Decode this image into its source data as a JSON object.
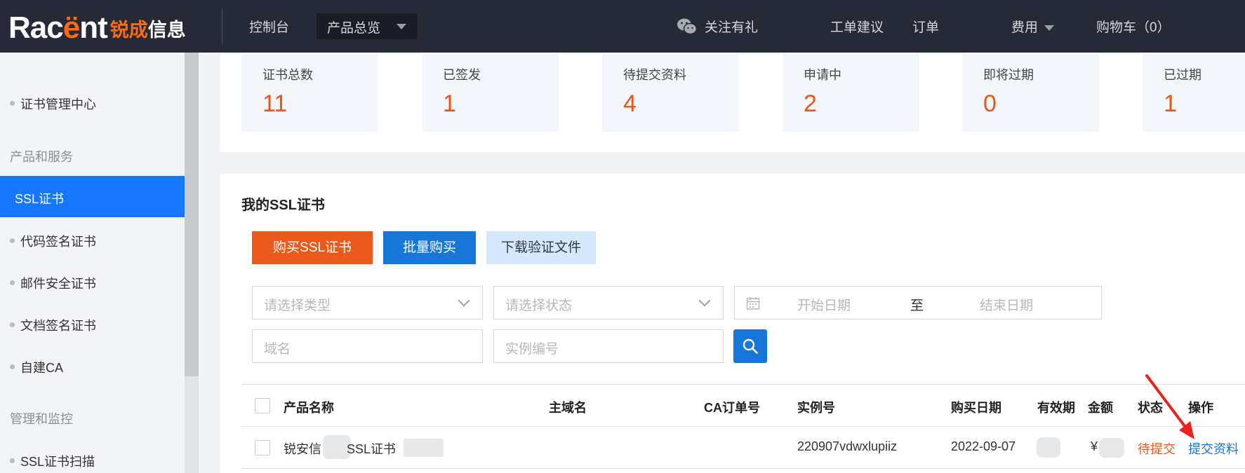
{
  "topbar": {
    "logo_text_1": "Rac",
    "logo_text_2": "ë",
    "logo_text_3": "nt",
    "logo_cn_1": "锐成",
    "logo_cn_2": "信息",
    "console": "控制台",
    "products_dropdown": "产品总览",
    "follow_gift": "关注有礼",
    "ticket": "工单建议",
    "orders": "订单",
    "fees": "费用",
    "cart": "购物车（0）"
  },
  "sidebar": {
    "cert_center": "证书管理中心",
    "group_products": "产品和服务",
    "ssl": "SSL证书",
    "code_sign": "代码签名证书",
    "mail_sec": "邮件安全证书",
    "doc_sign": "文档签名证书",
    "self_ca": "自建CA",
    "group_manage": "管理和监控",
    "ssl_scan": "SSL证书扫描"
  },
  "stats": [
    {
      "label": "证书总数",
      "value": "11"
    },
    {
      "label": "已签发",
      "value": "1"
    },
    {
      "label": "待提交资料",
      "value": "4"
    },
    {
      "label": "申请中",
      "value": "2"
    },
    {
      "label": "即将过期",
      "value": "0"
    },
    {
      "label": "已过期",
      "value": "1"
    }
  ],
  "main": {
    "title": "我的SSL证书",
    "buy_ssl": "购买SSL证书",
    "bulk_buy": "批量购买",
    "download_verify": "下载验证文件"
  },
  "filters": {
    "type_placeholder": "请选择类型",
    "status_placeholder": "请选择状态",
    "start_date": "开始日期",
    "to": "至",
    "end_date": "结束日期",
    "domain_placeholder": "域名",
    "instance_placeholder": "实例编号"
  },
  "table": {
    "headers": {
      "product": "产品名称",
      "domain": "主域名",
      "ca_order": "CA订单号",
      "instance": "实例号",
      "buy_date": "购买日期",
      "validity": "有效期",
      "amount": "金额",
      "status": "状态",
      "action": "操作"
    },
    "rows": [
      {
        "product_a": "锐安信",
        "product_b": "SSL证书",
        "instance": "220907vdwxlupiiz",
        "buy_date": "2022-09-07",
        "amount_prefix": "¥",
        "status": "待提交",
        "action": "提交资料"
      }
    ]
  },
  "colors": {
    "accent_orange": "#ec5a1b",
    "accent_blue": "#1677d8",
    "arrow_red": "#e8241c"
  }
}
